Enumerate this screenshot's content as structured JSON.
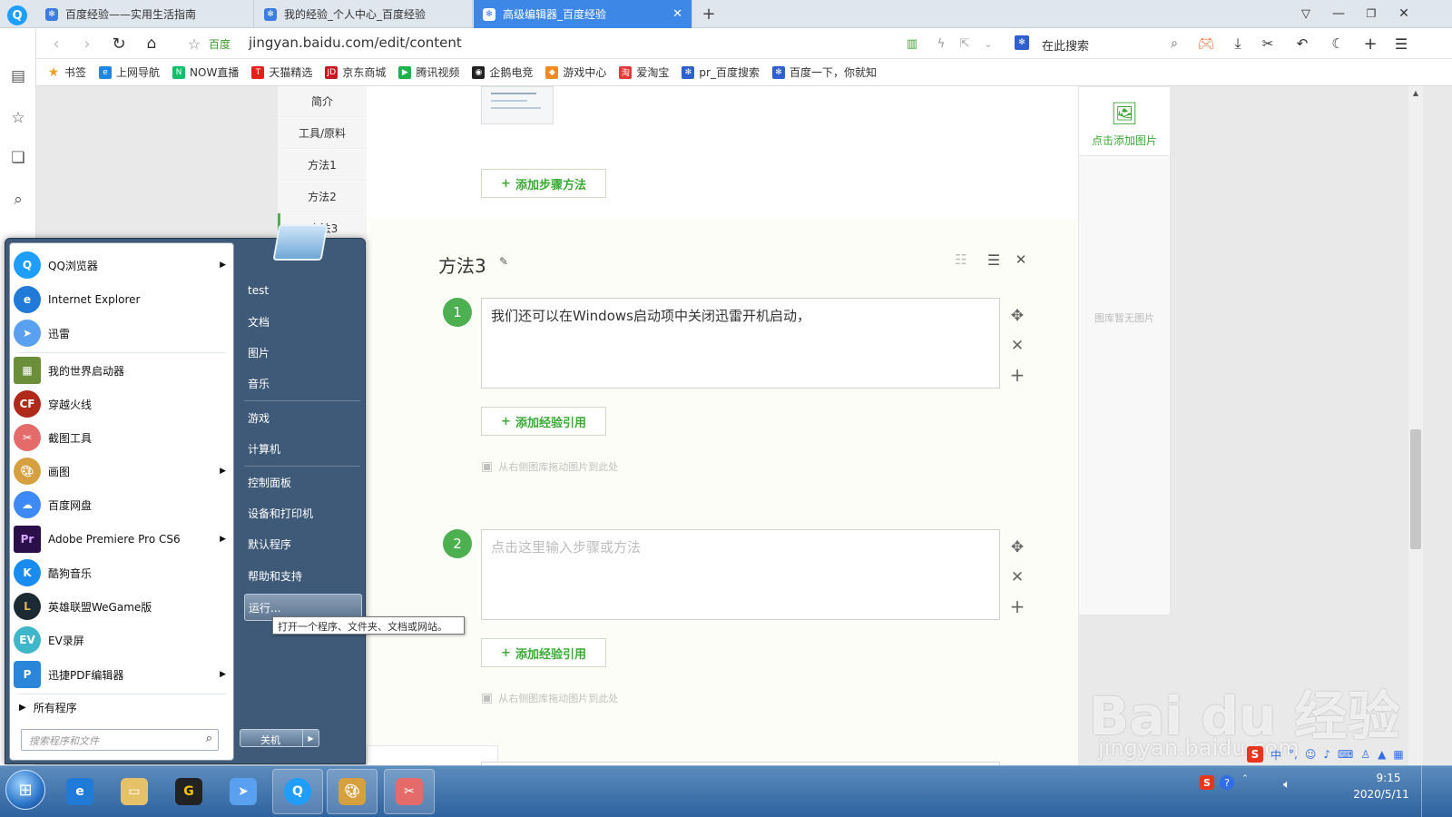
{
  "tabs": [
    {
      "label": "百度经验——实用生活指南",
      "favicon": "paw-icon"
    },
    {
      "label": "我的经验_个人中心_百度经验",
      "favicon": "paw-icon"
    },
    {
      "label": "高级编辑器_百度经验",
      "favicon": "paw-icon",
      "active": true
    }
  ],
  "address": {
    "search_engine": "百度",
    "url": "jingyan.baidu.com/edit/content",
    "search_placeholder": "在此搜索"
  },
  "bookmarks": [
    "书签",
    "上网导航",
    "NOW直播",
    "天猫精选",
    "京东商城",
    "腾讯视频",
    "企鹅电竞",
    "游戏中心",
    "爱淘宝",
    "pr_百度搜索",
    "百度一下，你就知"
  ],
  "outline": [
    "简介",
    "工具/原料",
    "方法1",
    "方法2",
    "方法3"
  ],
  "editor": {
    "add_step_label": "添加步骤方法",
    "section_title": "方法3",
    "steps": [
      {
        "num": "1",
        "text": "我们还可以在Windows启动项中关闭迅雷开机启动，",
        "placeholder": ""
      },
      {
        "num": "2",
        "text": "",
        "placeholder": "点击这里输入步骤或方法"
      }
    ],
    "add_ref_label": "添加经验引用",
    "drag_hint": "从右侧图库拖动图片到此处"
  },
  "right_panel": {
    "add_image_label": "点击添加图片",
    "empty_label": "图库暂无图片"
  },
  "start_menu": {
    "programs": [
      "QQ浏览器",
      "Internet Explorer",
      "迅雷",
      "我的世界启动器",
      "穿越火线",
      "截图工具",
      "画图",
      "百度网盘",
      "Adobe Premiere Pro CS6",
      "酷狗音乐",
      "英雄联盟WeGame版",
      "EV录屏",
      "迅捷PDF编辑器"
    ],
    "all_programs": "所有程序",
    "search_placeholder": "搜索程序和文件",
    "right_items": [
      "test",
      "文档",
      "图片",
      "音乐",
      "游戏",
      "计算机",
      "控制面板",
      "设备和打印机",
      "默认程序",
      "帮助和支持",
      "运行..."
    ],
    "shutdown_label": "关机",
    "tooltip": "打开一个程序、文件夹、文档或网站。"
  },
  "watermark": {
    "brand": "Bai du 经验",
    "url": "jingyan.baidu.com"
  },
  "taskbar": {
    "time": "9:15",
    "date": "2020/5/11"
  }
}
